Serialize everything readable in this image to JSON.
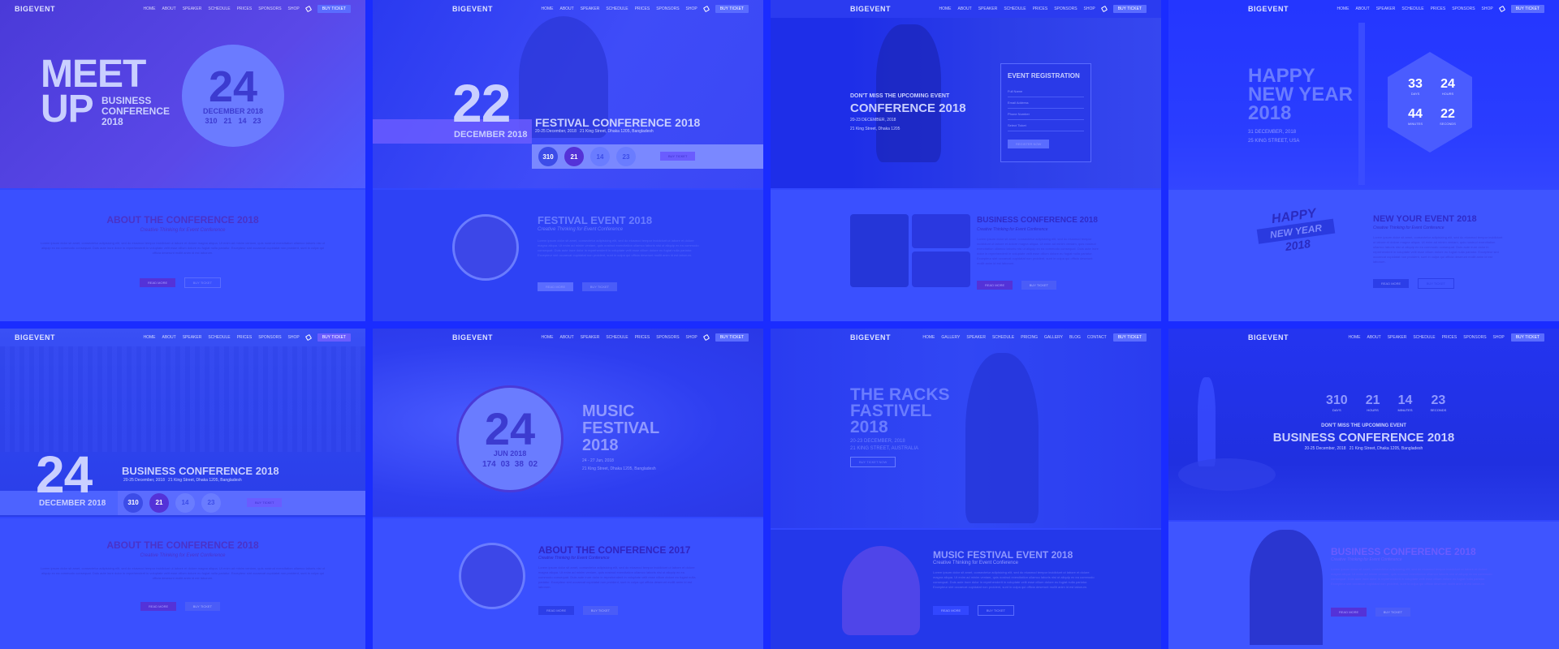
{
  "logo": "BIGEVENT",
  "nav": {
    "items": [
      "HOME",
      "ABOUT",
      "SPEAKER",
      "SCHEDULE",
      "PRICES",
      "SPONSORS",
      "SHOP"
    ],
    "buy": "BUY TICKET"
  },
  "nav2": {
    "items": [
      "HOME",
      "ABOUT",
      "SPEAKER",
      "SCHEDULE",
      "PRICES",
      "SPONSORS",
      "SHOP"
    ],
    "buy": "BUY TICKET"
  },
  "nav3": {
    "items": [
      "HOME",
      "GALLERY",
      "SPEAKER",
      "SCHEDULE",
      "PRICING",
      "GALLERY",
      "BLOG",
      "CONTACT"
    ],
    "buy": "BUY TICKET"
  },
  "d1": {
    "title": "MEET UP",
    "title_line2": "UP",
    "sub": [
      "BUSINESS",
      "CONFERENCE",
      "2018"
    ],
    "day": "24",
    "month": "DECEMBER 2018",
    "counts": [
      "310",
      "21",
      "14",
      "23"
    ],
    "count_labels": [
      "DAYS",
      "HRS",
      "MINS",
      "SEC"
    ],
    "about_title": "ABOUT THE CONFERENCE 2018",
    "about_sub": "Creative Thinking for Event Conference",
    "b1": "READ MORE",
    "b2": "BUY TICKET"
  },
  "d2": {
    "day": "22",
    "month": "DECEMBER 2018",
    "title": "FESTIVAL CONFERENCE 2018",
    "date": "20-25 December, 2018",
    "place": "21 King Street, Dhaka 1205, Bangladesh",
    "counts": [
      "310",
      "21",
      "14",
      "23"
    ],
    "count_labels": [
      "DAYS",
      "HOURS",
      "MINUTES",
      "SECONDS"
    ],
    "btn": "BUY TICKET",
    "event_title": "FESTIVAL EVENT 2018",
    "event_sub": "Creative Thinking for Event Conference",
    "b1": "READ MORE",
    "b2": "BUY TICKET"
  },
  "d3": {
    "pre": "DON'T MISS THE UPCOMING EVENT",
    "title": "CONFERENCE 2018",
    "date": "20-23 DECEMBER, 2018",
    "place": "21 King Street, Dhaka 1205",
    "form_title": "EVENT REGISTRATION",
    "fields": [
      "Full Name",
      "Email Address",
      "Phone Number",
      "Select Ticket"
    ],
    "submit": "REGISTER NOW",
    "biz_title": "BUSINESS CONFERENCE 2018",
    "biz_sub": "Creative Thinking for Event Conference",
    "b1": "READ MORE",
    "b2": "BUY TICKET"
  },
  "d4": {
    "title": [
      "HAPPY",
      "NEW YEAR",
      "2018"
    ],
    "date": "31 DECEMBER, 2018",
    "place": "25 KING STREET, USA",
    "counts": [
      "33",
      "24",
      "44",
      "22"
    ],
    "count_labels": [
      "DAYS",
      "HOURS",
      "MINUTES",
      "SECONDS"
    ],
    "badge": [
      "HAPPY",
      "NEW YEAR",
      "2018"
    ],
    "ev_title": "NEW YOUR EVENT 2018",
    "ev_sub": "Creative Thinking for Event Conference",
    "b1": "READ MORE",
    "b2": "BUY TICKET"
  },
  "d5": {
    "day": "24",
    "month": "DECEMBER 2018",
    "title": "BUSINESS CONFERENCE 2018",
    "date": "20-25 December, 2018",
    "place": "21 King Street, Dhaka 1205, Bangladesh",
    "counts": [
      "310",
      "21",
      "14",
      "23"
    ],
    "count_labels": [
      "DAYS",
      "HOURS",
      "MINUTES",
      "SECONDS"
    ],
    "btn": "BUY TICKET",
    "about_title": "ABOUT THE CONFERENCE 2018",
    "about_sub": "Creative Thinking for Event Conference",
    "b1": "READ MORE",
    "b2": "BUY TICKET"
  },
  "d6": {
    "day": "24",
    "month": "JUN 2018",
    "counts": [
      "174",
      "03",
      "38",
      "02"
    ],
    "count_labels": [
      "DAYS",
      "HOURS",
      "MINUTES",
      "SECONDS"
    ],
    "title": [
      "MUSIC",
      "FESTIVAL",
      "2018"
    ],
    "date": "24 - 27 Jun, 2018",
    "place": "21 King Street, Dhaka 1205, Bangladesh",
    "about_title": "ABOUT THE CONFERENCE 2017",
    "about_sub": "Creative Thinking for Event Conference",
    "b1": "READ MORE",
    "b2": "BUY TICKET"
  },
  "d7": {
    "title": [
      "THE RACKS",
      "FASTIVEL",
      "2018"
    ],
    "date": "20-23 DECEMBER, 2018",
    "place": "21 KING STREET, AUSTRALIA",
    "btn": "BUY TICKET NOW",
    "ev_title": "MUSIC FESTIVAL EVENT 2018",
    "ev_sub": "Creative Thinking for Event Conference",
    "b1": "READ MORE",
    "b2": "BUY TICKET"
  },
  "d8": {
    "counts": [
      "310",
      "21",
      "14",
      "23"
    ],
    "count_labels": [
      "DAYS",
      "HOURS",
      "MINUTES",
      "SECONDS"
    ],
    "pre": "DON'T MISS THE UPCOMING EVENT",
    "title": "BUSINESS CONFERENCE 2018",
    "date": "20-25 December, 2018",
    "place": "21 King Street, Dhaka 1205, Bangladesh",
    "biz_title": "BUSINESS CONFERENCE 2018",
    "biz_sub": "Creative Thinking for Event Conference",
    "b1": "READ MORE",
    "b2": "BUY TICKET"
  },
  "para": "Lorem ipsum dolor sit amet, consectetur adipisicing elit, sed do eiusmod tempor incididunt ut labore et dolore magna aliqua. Ut enim ad minim veniam, quis nostrud exercitation ullamco laboris nisi ut aliquip ex ea commodo consequat. Duis aute irure dolor in reprehenderit in voluptate velit esse cillum dolore eu fugiat nulla pariatur. Excepteur sint occaecat cupidatat non proident, sunt in culpa qui officia deserunt mollit anim id est laborum.",
  "colors": {
    "bg": "#1a2cff",
    "panel": "#3247ff",
    "accent": "#5a6cff",
    "purple": "#5432d8"
  }
}
